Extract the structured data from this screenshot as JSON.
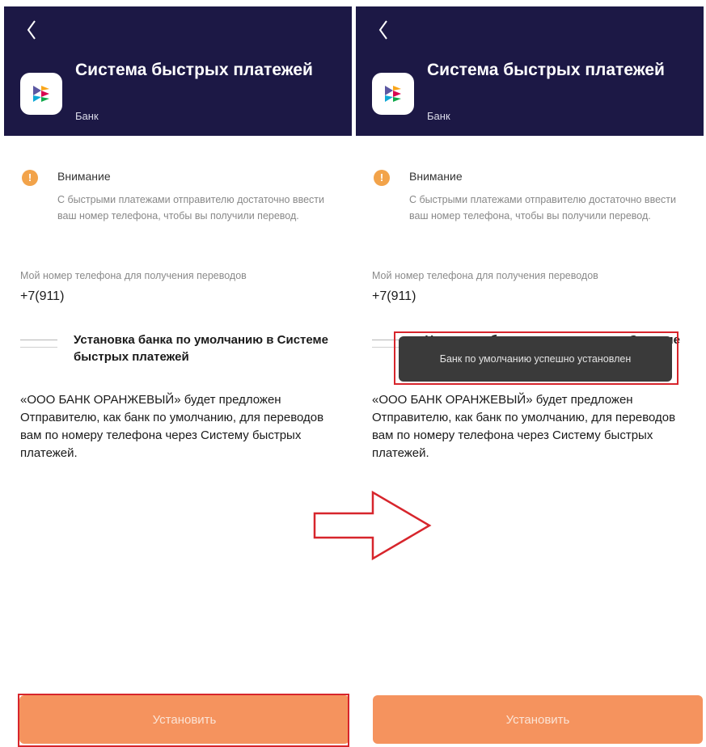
{
  "header": {
    "title": "Система быстрых платежей",
    "subtitle": "Банк"
  },
  "warning": {
    "title": "Внимание",
    "text": "С быстрыми платежами отправителю достаточно ввести ваш номер телефона, чтобы вы получили перевод."
  },
  "phone": {
    "label": "Мой номер телефона для получения переводов",
    "value": "+7(911)"
  },
  "default_bank": {
    "label": "Установка банка по умолчанию в Системе быстрых платежей",
    "description": "«ООО БАНК ОРАНЖЕВЫЙ» будет предложен Отправителю, как банк по умолчанию, для переводов вам по номеру телефона через Систему быстрых платежей."
  },
  "install_button": "Установить",
  "toast": "Банк по умолчанию успешно установлен",
  "colors": {
    "header_bg": "#1c1845",
    "button": "#f5935e",
    "warning": "#f2a34a",
    "highlight": "#d7252c"
  },
  "icons": [
    "back-arrow-icon",
    "sbp-logo-icon",
    "warning-icon",
    "arrow-right-icon"
  ]
}
